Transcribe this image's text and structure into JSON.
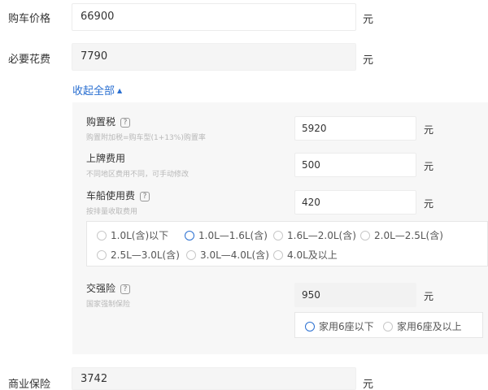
{
  "car_price": {
    "label": "购车价格",
    "value": "66900",
    "unit": "元"
  },
  "necessary_fees": {
    "label": "必要花费",
    "value": "7790",
    "unit": "元"
  },
  "collapse_link": {
    "label": "收起全部",
    "arrow": "▲"
  },
  "purchase_tax": {
    "title": "购置税",
    "subtitle": "购置附加税=购车型(1+13%)购置率",
    "value": "5920",
    "unit": "元",
    "help_icon": "question-icon"
  },
  "license_fee": {
    "title": "上牌费用",
    "subtitle": "不同地区费用不同，可手动修改",
    "value": "500",
    "unit": "元"
  },
  "vehicle_tax": {
    "title": "车船使用费",
    "subtitle": "按排量收取费用",
    "value": "420",
    "unit": "元",
    "help_icon": "question-icon",
    "options": [
      "1.0L(含)以下",
      "1.0L—1.6L(含)",
      "1.6L—2.0L(含)",
      "2.0L—2.5L(含)",
      "2.5L—3.0L(含)",
      "3.0L—4.0L(含)",
      "4.0L及以上"
    ],
    "selected": "1.0L—1.6L(含)"
  },
  "compulsory_insurance": {
    "title": "交强险",
    "subtitle": "国家强制保险",
    "value": "950",
    "unit": "元",
    "help_icon": "question-icon",
    "options": [
      "家用6座以下",
      "家用6座及以上"
    ],
    "selected": "家用6座以下"
  },
  "commercial_insurance": {
    "label": "商业保险",
    "value": "3742",
    "unit": "元"
  },
  "colors": {
    "accent": "#2a6fd1",
    "panel_bg": "#f7f7f7"
  }
}
